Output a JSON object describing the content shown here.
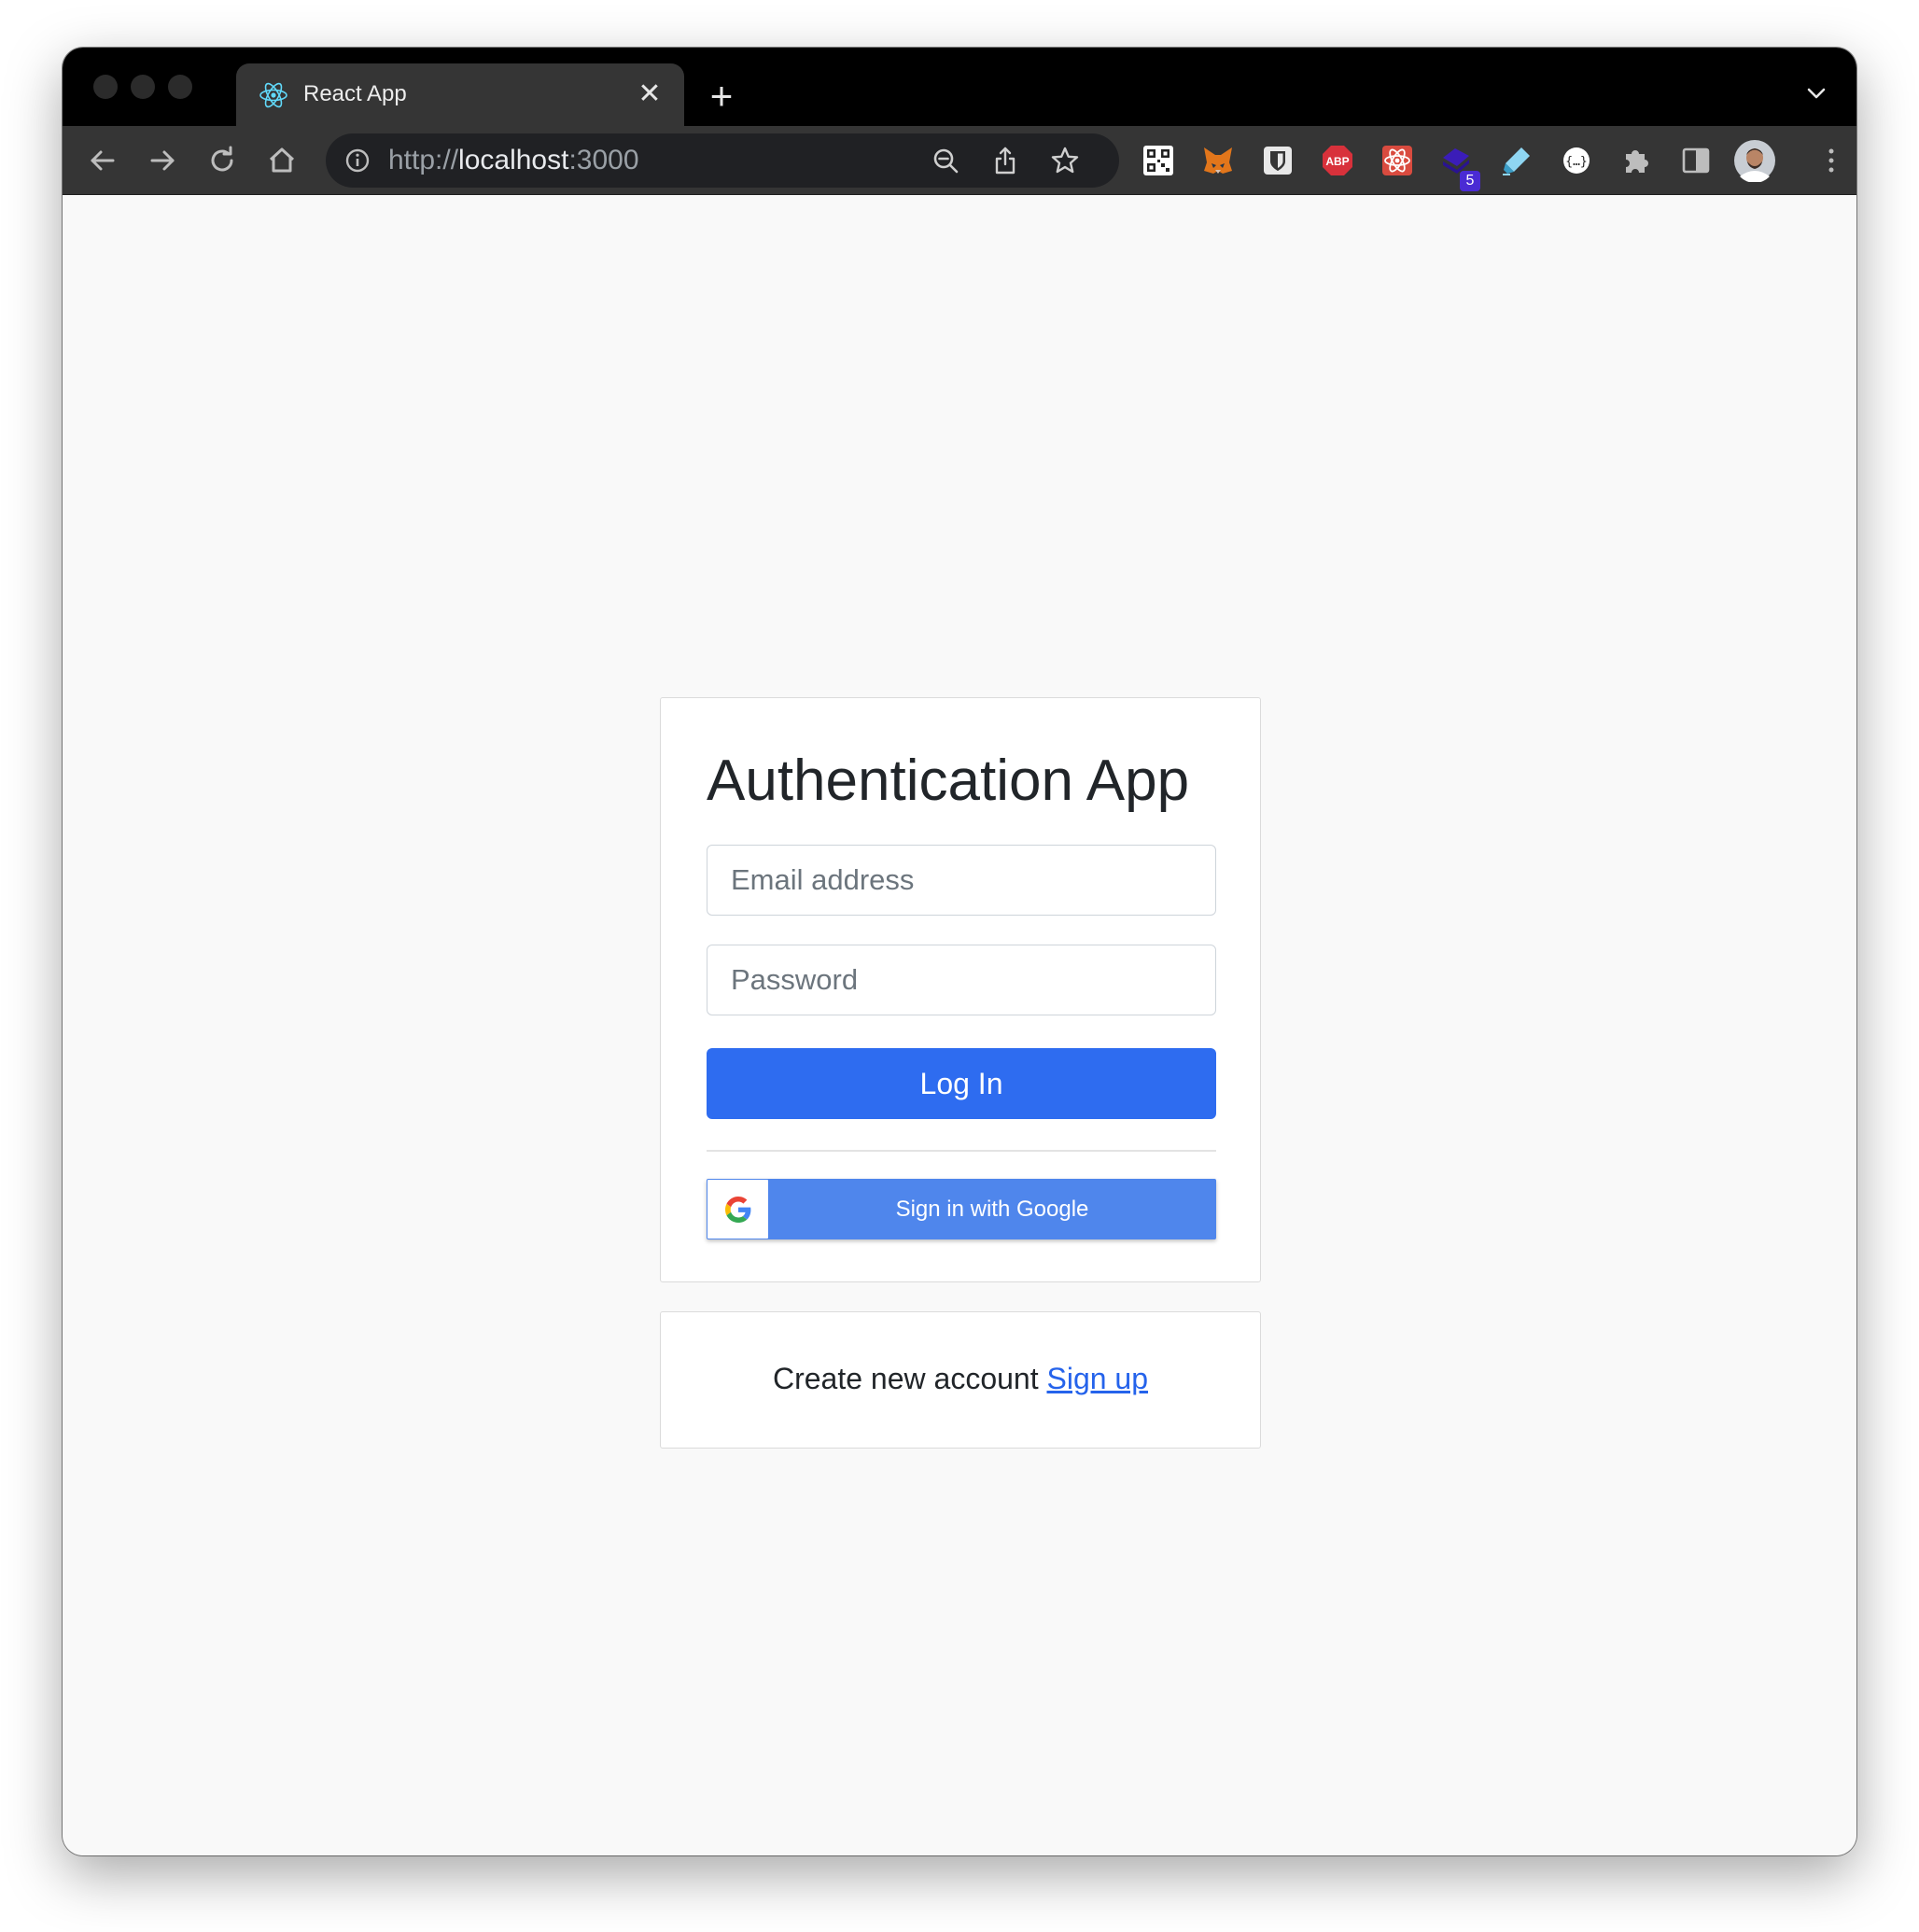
{
  "browser": {
    "tab": {
      "title": "React App",
      "favicon": "react-logo-icon"
    },
    "new_tab_icon": "plus-icon",
    "address_bar": {
      "scheme": "http://",
      "host": "localhost",
      "port": ":3000"
    },
    "extensions": [
      "qr-code-icon",
      "metamask-fox-icon",
      "bitwarden-shield-icon",
      "adblock-plus-icon",
      "react-devtools-icon",
      "stack-extension-icon",
      "highlighter-icon",
      "json-viewer-icon",
      "puzzle-icon",
      "side-panel-icon",
      "profile-avatar"
    ],
    "extension_badge": "5"
  },
  "login": {
    "title": "Authentication App",
    "email_placeholder": "Email address",
    "email_value": "",
    "password_placeholder": "Password",
    "password_value": "",
    "login_button": "Log In",
    "google_button": "Sign in with Google"
  },
  "signup": {
    "prompt": "Create new account ",
    "link": "Sign up"
  },
  "colors": {
    "primary": "#2e6cf0",
    "google_button": "#4f86ec",
    "link": "#2563eb",
    "page_background": "#f9f9f9"
  }
}
